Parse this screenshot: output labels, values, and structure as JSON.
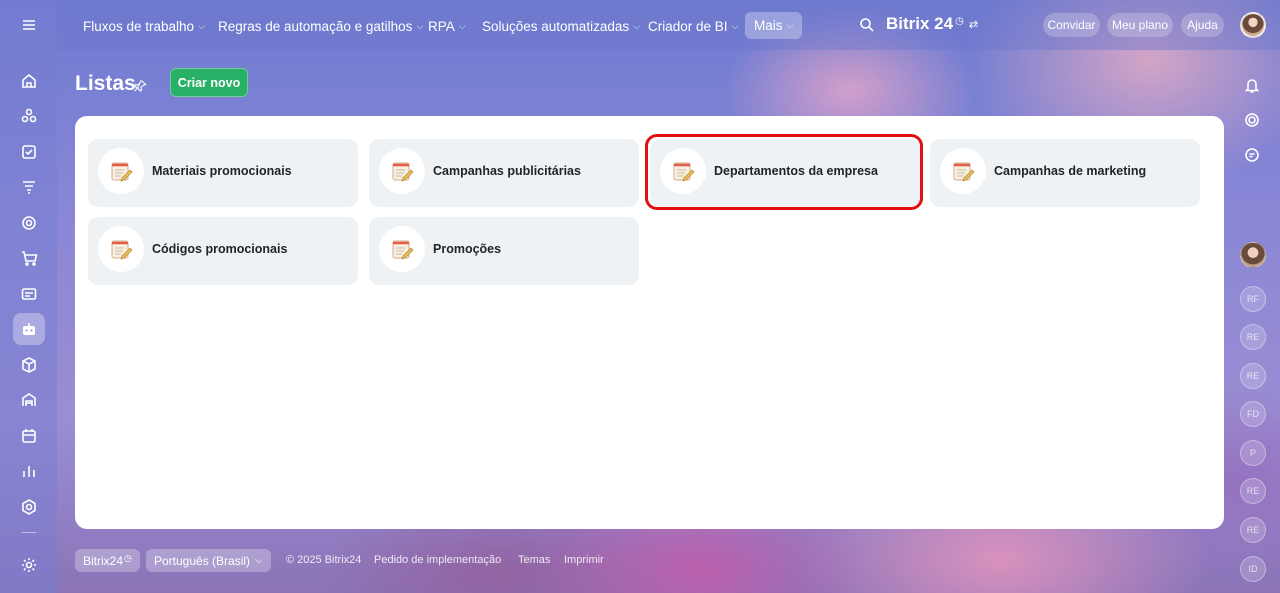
{
  "topbar": {
    "nav": [
      {
        "label": "Fluxos de trabalho",
        "chevron": "⌵"
      },
      {
        "label": "Regras de automação e gatilhos",
        "chevron": "⌵"
      },
      {
        "label": "RPA",
        "chevron": "⌵"
      },
      {
        "label": "Soluções automatizadas",
        "chevron": "⌵"
      },
      {
        "label": "Criador de BI",
        "chevron": "⌵"
      },
      {
        "label": "Mais",
        "chevron": "⌵"
      }
    ],
    "brand": "Bitrix 24",
    "brand_clock": "◷",
    "brand_swap": "⇄",
    "invite": "Convidar",
    "my_plan": "Meu plano",
    "help": "Ajuda"
  },
  "page": {
    "title": "Listas",
    "create_button": "Criar novo"
  },
  "lists": [
    {
      "label": "Materiais promocionais"
    },
    {
      "label": "Campanhas publicitárias"
    },
    {
      "label": "Departamentos da empresa"
    },
    {
      "label": "Campanhas de marketing"
    },
    {
      "label": "Códigos promocionais"
    },
    {
      "label": "Promoções"
    }
  ],
  "rightbar": {
    "avatars": [
      "RF",
      "RE",
      "RE",
      "FD",
      "P",
      "RE",
      "RE",
      "ID"
    ]
  },
  "footer": {
    "brand": "Bitrix24",
    "brand_clock": "◷",
    "language": "Português (Brasil)",
    "language_chevron": "⌵",
    "copyright": "© 2025 Bitrix24",
    "links": [
      "Pedido de implementação",
      "Temas",
      "Imprimir"
    ]
  },
  "colors": {
    "accent_green": "#27b066",
    "highlight_red": "#e01010",
    "card_bg": "#eef2f4"
  }
}
